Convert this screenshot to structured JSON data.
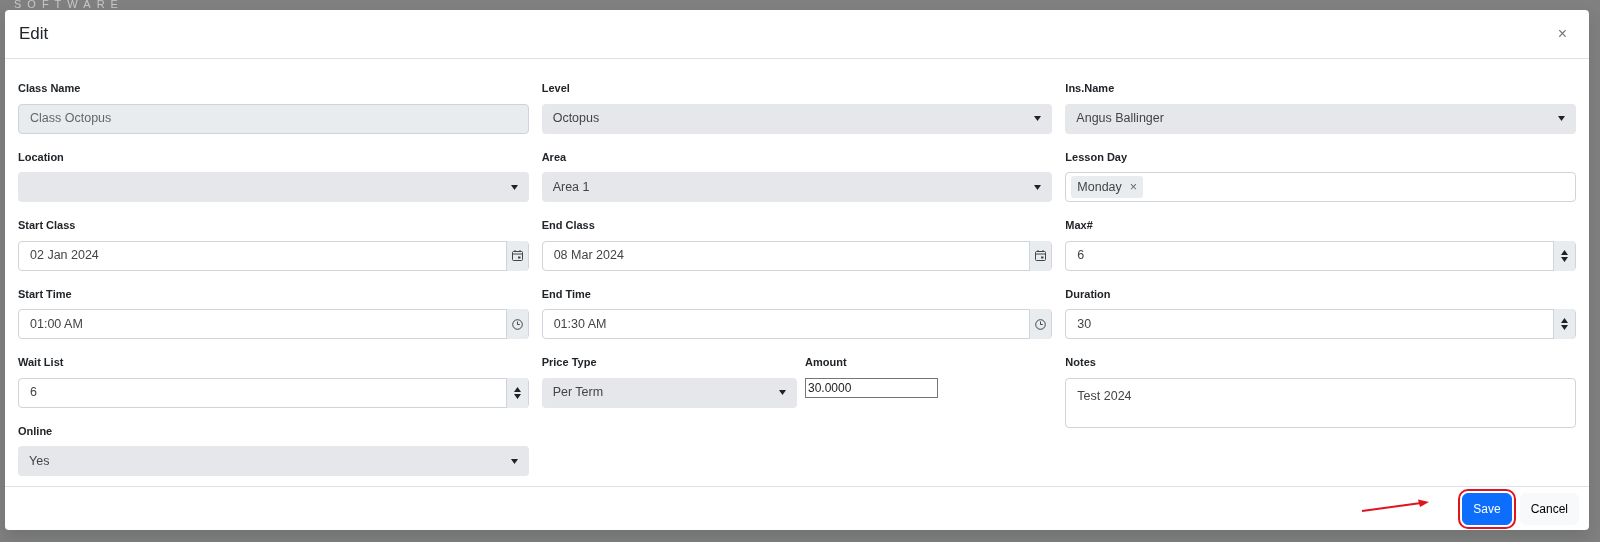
{
  "backdrop": {
    "logo_text": "SOFTWARE"
  },
  "modal": {
    "title": "Edit",
    "close": "×",
    "columns": [
      [
        {
          "kind": "text",
          "label": "Class Name",
          "value": "Class Octopus",
          "readonly": true
        },
        {
          "kind": "select",
          "label": "Location"
        },
        {
          "kind": "date",
          "label": "Start Class",
          "value": "02 Jan 2024"
        },
        {
          "kind": "time",
          "label": "Start Time",
          "value": "01:00 AM"
        },
        {
          "kind": "number",
          "label": "Wait List",
          "value": "6"
        },
        {
          "kind": "select",
          "label": "Online",
          "value": "Yes"
        }
      ],
      [
        {
          "kind": "select",
          "label": "Level",
          "value": "Octopus"
        },
        {
          "kind": "select",
          "label": "Area",
          "value": "Area 1"
        },
        {
          "kind": "date",
          "label": "End Class",
          "value": "08 Mar 2024"
        },
        {
          "kind": "time",
          "label": "End Time",
          "value": "01:30 AM"
        },
        {
          "kind": "pair",
          "items": [
            {
              "kind": "select",
              "label": "Price Type",
              "value": "Per Term"
            },
            {
              "kind": "plain",
              "label": "Amount",
              "value": "30.0000"
            }
          ]
        }
      ],
      [
        {
          "kind": "select",
          "label": "Ins.Name",
          "value": "Angus Ballinger"
        },
        {
          "kind": "tags",
          "label": "Lesson Day",
          "tags": [
            {
              "text": "Monday",
              "remove": "×"
            }
          ]
        },
        {
          "kind": "number",
          "label": "Max#",
          "value": "6"
        },
        {
          "kind": "number",
          "label": "Duration",
          "value": "30"
        },
        {
          "kind": "textarea",
          "label": "Notes",
          "value": "Test 2024"
        }
      ]
    ],
    "buttons": [
      {
        "kind": "primary",
        "label": "Save",
        "highlighted": true
      },
      {
        "kind": "secondary",
        "label": "Cancel",
        "highlighted": false
      }
    ]
  }
}
